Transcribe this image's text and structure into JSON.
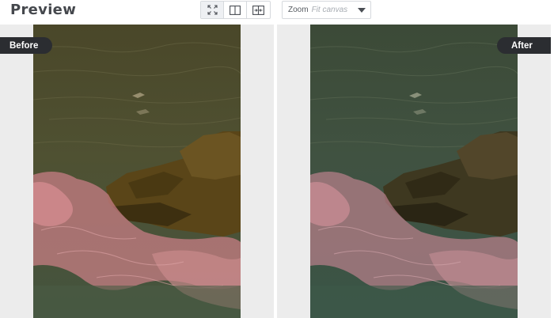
{
  "header": {
    "title": "Preview",
    "view_modes": [
      {
        "name": "fit-view",
        "icon": "expand-arrows-icon",
        "active": true
      },
      {
        "name": "split-view",
        "icon": "split-panes-icon",
        "active": false
      },
      {
        "name": "side-by-side-view",
        "icon": "side-by-side-arrows-icon",
        "active": false
      }
    ],
    "zoom": {
      "label": "Zoom",
      "value": "Fit canvas"
    }
  },
  "preview": {
    "before_label": "Before",
    "after_label": "After"
  },
  "colors": {
    "badge_bg": "#2b2d31",
    "pane_bg": "#ececec",
    "title_text": "#45484d"
  }
}
